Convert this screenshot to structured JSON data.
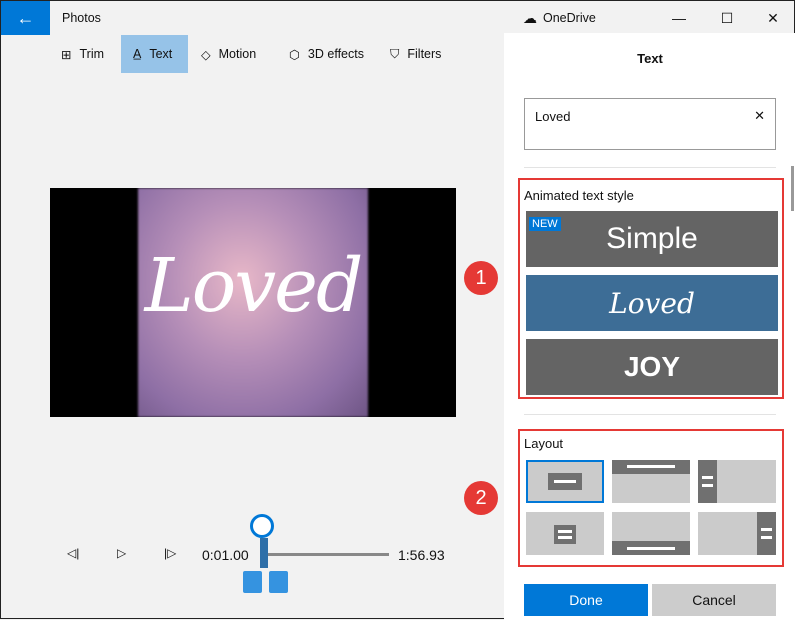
{
  "app": {
    "title": "Photos",
    "onedrive": "OneDrive"
  },
  "toolbar": [
    {
      "label": "Trim",
      "icon": "trim-icon"
    },
    {
      "label": "Text",
      "icon": "text-icon"
    },
    {
      "label": "Motion",
      "icon": "motion-icon"
    },
    {
      "label": "3D effects",
      "icon": "3d-effects-icon"
    },
    {
      "label": "Filters",
      "icon": "filters-icon"
    }
  ],
  "preview": {
    "overlay_text": "Loved"
  },
  "player": {
    "current_time": "0:01.00",
    "total_time": "1:56.93",
    "progress_fraction": 0.01
  },
  "badges": [
    "1",
    "2"
  ],
  "panel": {
    "title": "Text",
    "text_value": "Loved",
    "animated_label": "Animated text style",
    "styles": [
      {
        "label": "Simple",
        "badge": "NEW"
      },
      {
        "label": "Loved"
      },
      {
        "label": "JOY"
      }
    ],
    "layout_label": "Layout",
    "done": "Done",
    "cancel": "Cancel"
  },
  "colors": {
    "accent": "#0078d7",
    "annotation": "#e53935"
  }
}
